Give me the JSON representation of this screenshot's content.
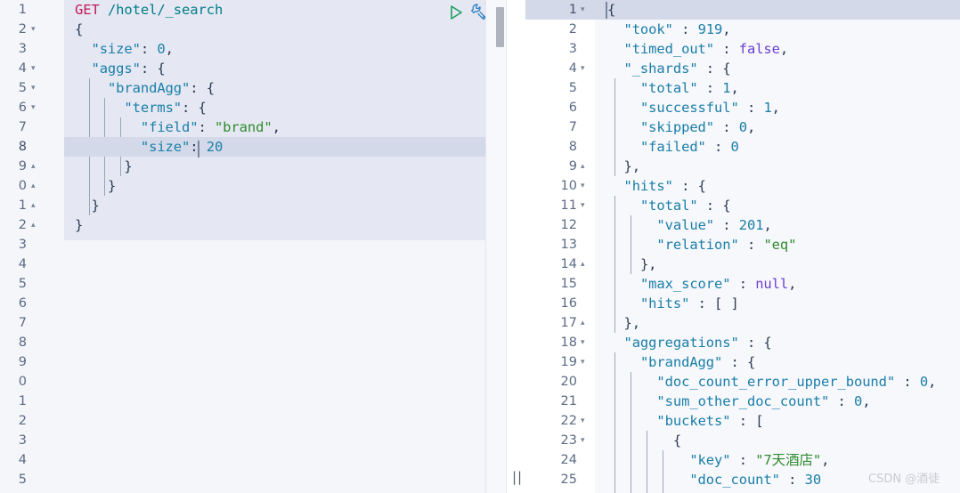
{
  "editor": {
    "request": {
      "method": "GET",
      "path": "/hotel/_search",
      "lines": [
        {
          "n": "1",
          "fold": "",
          "text": ""
        },
        {
          "n": "2",
          "fold": "▾",
          "text": "{"
        },
        {
          "n": "3",
          "fold": "",
          "text": "  \"size\": 0,"
        },
        {
          "n": "4",
          "fold": "▾",
          "text": "  \"aggs\": {"
        },
        {
          "n": "5",
          "fold": "▾",
          "text": "    \"brandAgg\": {"
        },
        {
          "n": "6",
          "fold": "▾",
          "text": "      \"terms\": {"
        },
        {
          "n": "7",
          "fold": "",
          "text": "        \"field\": \"brand\","
        },
        {
          "n": "8",
          "fold": "",
          "text": "        \"size\": 20"
        },
        {
          "n": "9",
          "fold": "▴",
          "text": "      }"
        },
        {
          "n": "0",
          "fold": "▴",
          "text": "    }"
        },
        {
          "n": "1",
          "fold": "▴",
          "text": "  }"
        },
        {
          "n": "2",
          "fold": "▴",
          "text": "}"
        },
        {
          "n": "3",
          "fold": "",
          "text": ""
        },
        {
          "n": "4",
          "fold": "",
          "text": ""
        },
        {
          "n": "5",
          "fold": "",
          "text": ""
        },
        {
          "n": "6",
          "fold": "",
          "text": ""
        },
        {
          "n": "7",
          "fold": "",
          "text": ""
        },
        {
          "n": "8",
          "fold": "",
          "text": ""
        },
        {
          "n": "9",
          "fold": "",
          "text": ""
        },
        {
          "n": "0",
          "fold": "",
          "text": ""
        },
        {
          "n": "1",
          "fold": "",
          "text": ""
        },
        {
          "n": "2",
          "fold": "",
          "text": ""
        },
        {
          "n": "3",
          "fold": "",
          "text": ""
        },
        {
          "n": "4",
          "fold": "",
          "text": ""
        },
        {
          "n": "5",
          "fold": "",
          "text": ""
        }
      ],
      "current_line": "8"
    },
    "response": {
      "lines": [
        {
          "n": "1",
          "fold": "▾",
          "text": "{"
        },
        {
          "n": "2",
          "fold": "",
          "text": "  \"took\" : 919,"
        },
        {
          "n": "3",
          "fold": "",
          "text": "  \"timed_out\" : false,"
        },
        {
          "n": "4",
          "fold": "▾",
          "text": "  \"_shards\" : {"
        },
        {
          "n": "5",
          "fold": "",
          "text": "    \"total\" : 1,"
        },
        {
          "n": "6",
          "fold": "",
          "text": "    \"successful\" : 1,"
        },
        {
          "n": "7",
          "fold": "",
          "text": "    \"skipped\" : 0,"
        },
        {
          "n": "8",
          "fold": "",
          "text": "    \"failed\" : 0"
        },
        {
          "n": "9",
          "fold": "▴",
          "text": "  },"
        },
        {
          "n": "10",
          "fold": "▾",
          "text": "  \"hits\" : {"
        },
        {
          "n": "11",
          "fold": "▾",
          "text": "    \"total\" : {"
        },
        {
          "n": "12",
          "fold": "",
          "text": "      \"value\" : 201,"
        },
        {
          "n": "13",
          "fold": "",
          "text": "      \"relation\" : \"eq\""
        },
        {
          "n": "14",
          "fold": "▴",
          "text": "    },"
        },
        {
          "n": "15",
          "fold": "",
          "text": "    \"max_score\" : null,"
        },
        {
          "n": "16",
          "fold": "",
          "text": "    \"hits\" : [ ]"
        },
        {
          "n": "17",
          "fold": "▴",
          "text": "  },"
        },
        {
          "n": "18",
          "fold": "▾",
          "text": "  \"aggregations\" : {"
        },
        {
          "n": "19",
          "fold": "▾",
          "text": "    \"brandAgg\" : {"
        },
        {
          "n": "20",
          "fold": "",
          "text": "      \"doc_count_error_upper_bound\" : 0,"
        },
        {
          "n": "21",
          "fold": "",
          "text": "      \"sum_other_doc_count\" : 0,"
        },
        {
          "n": "22",
          "fold": "▾",
          "text": "      \"buckets\" : ["
        },
        {
          "n": "23",
          "fold": "▾",
          "text": "        {"
        },
        {
          "n": "24",
          "fold": "",
          "text": "          \"key\" : \"7天酒店\","
        },
        {
          "n": "25",
          "fold": "",
          "text": "          \"doc_count\" : 30"
        }
      ],
      "current_line": "1"
    }
  },
  "toolbar": {
    "run_label": "run-request",
    "settings_label": "edit-configuration"
  },
  "divider": {
    "grip": "||"
  },
  "watermark": {
    "text": "CSDN @酒徒"
  },
  "colors": {
    "method": "#c2185b",
    "path": "#007c8a",
    "key": "#1a7ea8",
    "string": "#2e8b2e",
    "number": "#1a7ea8",
    "keyword": "#6a3fd4",
    "editor_bg": "#e5e8f2",
    "panel_bg": "#f5f6fa",
    "response_bg": "#f7f8fc",
    "current_line": "#d3d9e8"
  }
}
